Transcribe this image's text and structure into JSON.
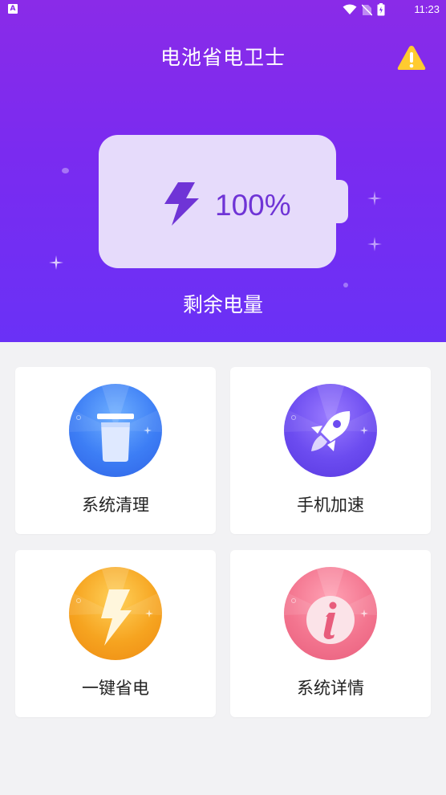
{
  "status_bar": {
    "app_badge": "A",
    "time": "11:23"
  },
  "header": {
    "title": "电池省电卫士",
    "battery_percent": "100%",
    "battery_level": 1.0,
    "remaining_label": "剩余电量",
    "warning_icon": "warning-triangle-icon"
  },
  "features": [
    {
      "label": "系统清理",
      "icon": "trash-can-icon",
      "color": "#3f7cf5"
    },
    {
      "label": "手机加速",
      "icon": "rocket-icon",
      "color": "#6c4cf0"
    },
    {
      "label": "一键省电",
      "icon": "lightning-bolt-icon",
      "color": "#f6a020"
    },
    {
      "label": "系统详情",
      "icon": "info-icon",
      "color": "#f0728f"
    }
  ],
  "colors": {
    "header_top": "#8a2be8",
    "header_bottom": "#6a31f6",
    "battery_fill": "#e6dbfb",
    "battery_accent": "#6f34d6",
    "background": "#f2f2f4"
  }
}
